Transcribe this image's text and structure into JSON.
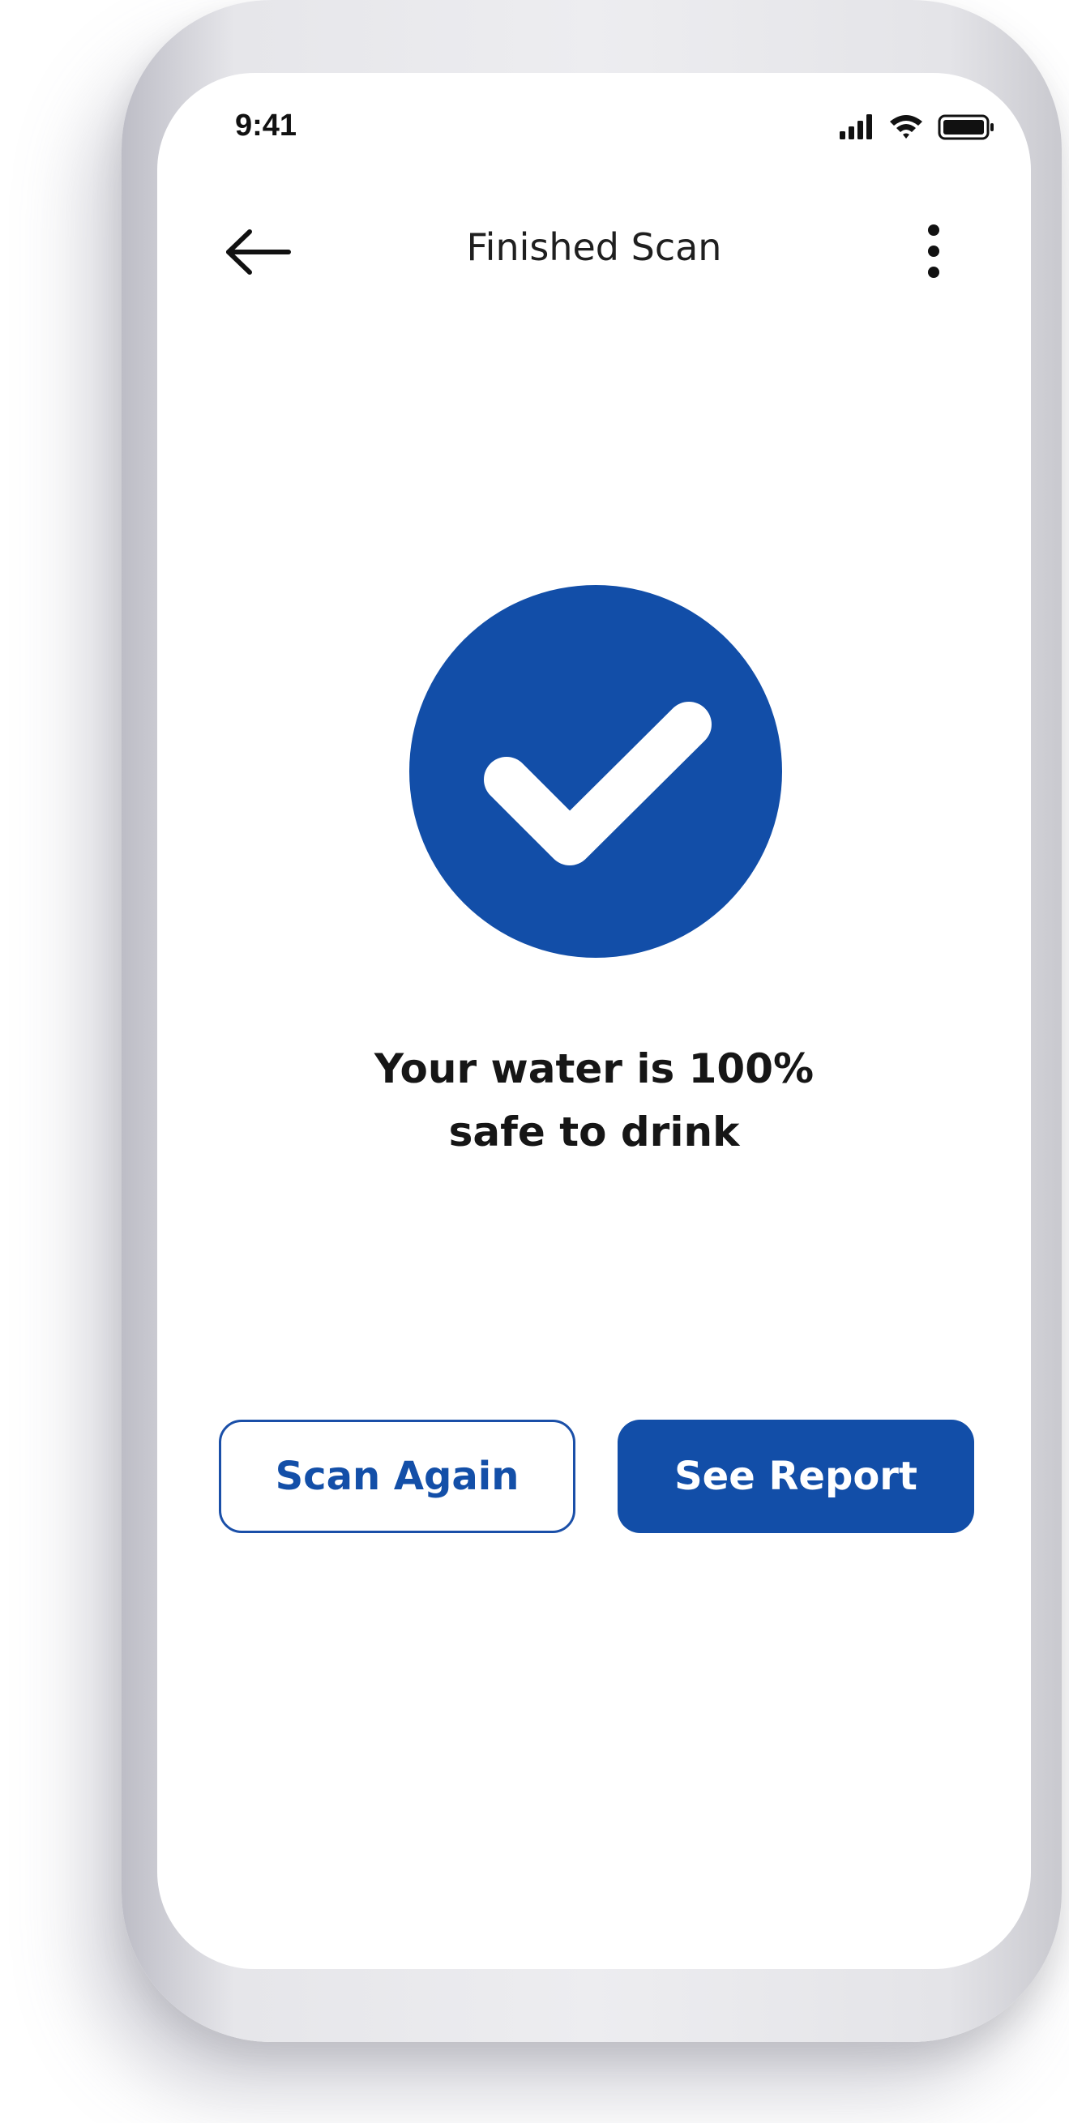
{
  "status_bar": {
    "time": "9:41",
    "icons": [
      "signal-icon",
      "wifi-icon",
      "battery-icon"
    ]
  },
  "nav": {
    "back_icon": "arrow-left-icon",
    "title": "Finished Scan",
    "more_icon": "more-vertical-icon"
  },
  "result": {
    "icon": "checkmark-circle-icon",
    "line1": "Your water is 100%",
    "line2": "safe to drink"
  },
  "actions": {
    "scan_again_label": "Scan Again",
    "see_report_label": "See Report"
  },
  "colors": {
    "accent": "#124EA8",
    "text": "#161616",
    "background": "#FFFFFF"
  }
}
